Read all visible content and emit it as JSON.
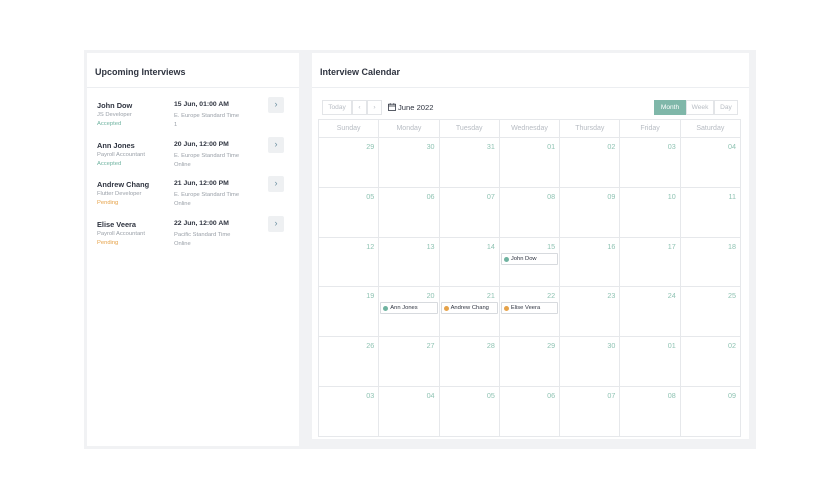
{
  "left_panel": {
    "title": "Upcoming Interviews",
    "interviews": [
      {
        "name": "John Dow",
        "role": "JS Developer",
        "status": "Accepted",
        "status_color": "#6fb3a0",
        "date": "15 Jun, 01:00 AM",
        "zone": "E. Europe Standard Time",
        "mode": "1"
      },
      {
        "name": "Ann Jones",
        "role": "Payroll Accountant",
        "status": "Accepted",
        "status_color": "#6fb3a0",
        "date": "20 Jun, 12:00 PM",
        "zone": "E. Europe Standard Time",
        "mode": "Online"
      },
      {
        "name": "Andrew Chang",
        "role": "Flutter Developer",
        "status": "Pending",
        "status_color": "#e6a34a",
        "date": "21 Jun, 12:00 PM",
        "zone": "E. Europe Standard Time",
        "mode": "Online"
      },
      {
        "name": "Elise Veera",
        "role": "Payroll Accountant",
        "status": "Pending",
        "status_color": "#e6a34a",
        "date": "22 Jun, 12:00 AM",
        "zone": "Pacific Standard Time",
        "mode": "Online"
      }
    ],
    "open_icon": "chevron-right-icon",
    "open_glyph": "›"
  },
  "right_panel": {
    "title": "Interview Calendar",
    "toolbar": {
      "today_label": "Today",
      "prev_glyph": "‹",
      "next_glyph": "›",
      "calendar_icon": "calendar-icon",
      "month_label": "June 2022"
    },
    "views": [
      {
        "label": "Month",
        "active": true
      },
      {
        "label": "Week",
        "active": false
      },
      {
        "label": "Day",
        "active": false
      }
    ],
    "weekdays": [
      "Sunday",
      "Monday",
      "Tuesday",
      "Wednesday",
      "Thursday",
      "Friday",
      "Saturday"
    ],
    "weeks": [
      [
        "29",
        "30",
        "31",
        "01",
        "02",
        "03",
        "04"
      ],
      [
        "05",
        "06",
        "07",
        "08",
        "09",
        "10",
        "11"
      ],
      [
        "12",
        "13",
        "14",
        "15",
        "16",
        "17",
        "18"
      ],
      [
        "19",
        "20",
        "21",
        "22",
        "23",
        "24",
        "25"
      ],
      [
        "26",
        "27",
        "28",
        "29",
        "30",
        "01",
        "02"
      ],
      [
        "03",
        "04",
        "05",
        "06",
        "07",
        "08",
        "09"
      ]
    ],
    "events": [
      {
        "week": 2,
        "day": 3,
        "label": "John Dow",
        "color": "#6fb3a0"
      },
      {
        "week": 3,
        "day": 1,
        "label": "Ann Jones",
        "color": "#6fb3a0"
      },
      {
        "week": 3,
        "day": 2,
        "label": "Andrew Chang",
        "color": "#e6a34a"
      },
      {
        "week": 3,
        "day": 3,
        "label": "Elise Veera",
        "color": "#e6a34a"
      }
    ]
  }
}
